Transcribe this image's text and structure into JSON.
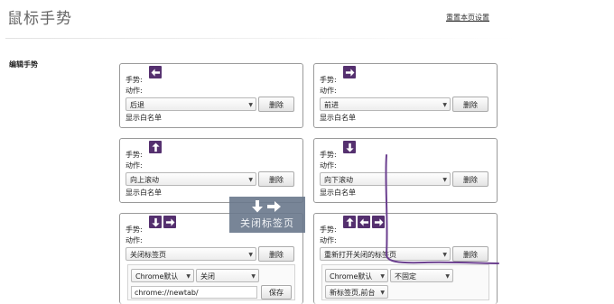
{
  "page": {
    "title": "鼠标手势",
    "reset_link": "重置本页设置",
    "section_label": "编辑手势"
  },
  "labels": {
    "gesture": "手势:",
    "action": "动作:",
    "delete": "删除",
    "whitelist": "显示白名单",
    "save": "保存"
  },
  "cards": [
    {
      "id": "back",
      "arrows": [
        "left"
      ],
      "action": "后退"
    },
    {
      "id": "forward",
      "arrows": [
        "right"
      ],
      "action": "前进"
    },
    {
      "id": "scroll-up",
      "arrows": [
        "up"
      ],
      "action": "向上滚动"
    },
    {
      "id": "scroll-down",
      "arrows": [
        "down"
      ],
      "action": "向下滚动"
    },
    {
      "id": "close-tab",
      "arrows": [
        "down",
        "right"
      ],
      "action": "关闭标签页",
      "options": {
        "browser": "Chrome默认",
        "mode": "关闭",
        "url": "chrome://newtab/"
      }
    },
    {
      "id": "reopen-tab",
      "arrows": [
        "up",
        "left",
        "right"
      ],
      "action": "重新打开关闭的标签页",
      "options": {
        "browser": "Chrome默认",
        "mode": "不固定",
        "position": "新标签页,前台"
      }
    }
  ],
  "overlay": {
    "arrows": [
      "down",
      "right"
    ],
    "text": "关闭标签页"
  }
}
